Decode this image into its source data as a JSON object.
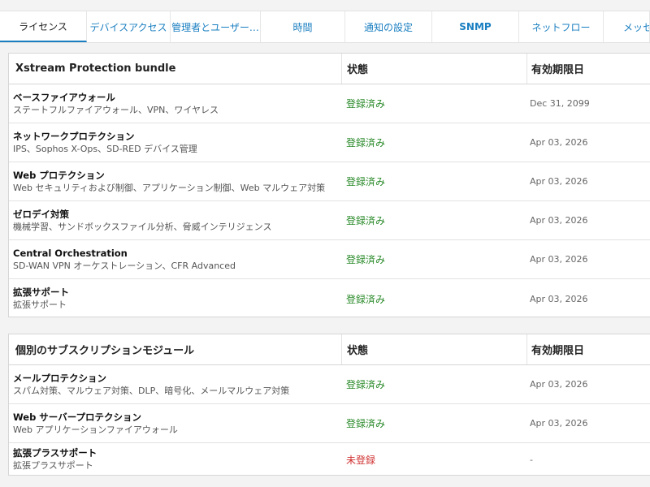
{
  "tabs": [
    {
      "label": "ライセンス"
    },
    {
      "label": "デバイスアクセス"
    },
    {
      "label": "管理者とユーザー…"
    },
    {
      "label": "時間"
    },
    {
      "label": "通知の設定"
    },
    {
      "label": "SNMP"
    },
    {
      "label": "ネットフロー"
    },
    {
      "label": "メッセ"
    }
  ],
  "bundle": {
    "title": "Xstream Protection bundle",
    "status_header": "状態",
    "expiry_header": "有効期限日",
    "rows": [
      {
        "name": "ベースファイアウォール",
        "desc": "ステートフルファイアウォール、VPN、ワイヤレス",
        "status": "登録済み",
        "expiry": "Dec 31, 2099"
      },
      {
        "name": "ネットワークプロテクション",
        "desc": "IPS、Sophos X-Ops、SD-RED デバイス管理",
        "status": "登録済み",
        "expiry": "Apr 03, 2026"
      },
      {
        "name": "Web プロテクション",
        "desc": "Web セキュリティおよび制御、アプリケーション制御、Web マルウェア対策",
        "status": "登録済み",
        "expiry": "Apr 03, 2026"
      },
      {
        "name": "ゼロデイ対策",
        "desc": "機械学習、サンドボックスファイル分析、脅威インテリジェンス",
        "status": "登録済み",
        "expiry": "Apr 03, 2026"
      },
      {
        "name": "Central Orchestration",
        "desc": "SD-WAN VPN オーケストレーション、CFR Advanced",
        "status": "登録済み",
        "expiry": "Apr 03, 2026"
      },
      {
        "name": "拡張サポート",
        "desc": "拡張サポート",
        "status": "登録済み",
        "expiry": "Apr 03, 2026"
      }
    ]
  },
  "modules": {
    "title": "個別のサブスクリプションモジュール",
    "status_header": "状態",
    "expiry_header": "有効期限日",
    "rows": [
      {
        "name": "メールプロテクション",
        "desc": "スパム対策、マルウェア対策、DLP、暗号化、メールマルウェア対策",
        "status": "登録済み",
        "expiry": "Apr 03, 2026"
      },
      {
        "name": "Web サーバープロテクション",
        "desc": "Web アプリケーションファイアウォール",
        "status": "登録済み",
        "expiry": "Apr 03, 2026"
      },
      {
        "name": "拡張プラスサポート",
        "desc": "拡張プラスサポート",
        "status": "未登録",
        "expiry": "-"
      }
    ]
  },
  "colors": {
    "accent": "#1a7fc1",
    "registered": "#2a8a2a",
    "unregistered": "#d03030"
  }
}
